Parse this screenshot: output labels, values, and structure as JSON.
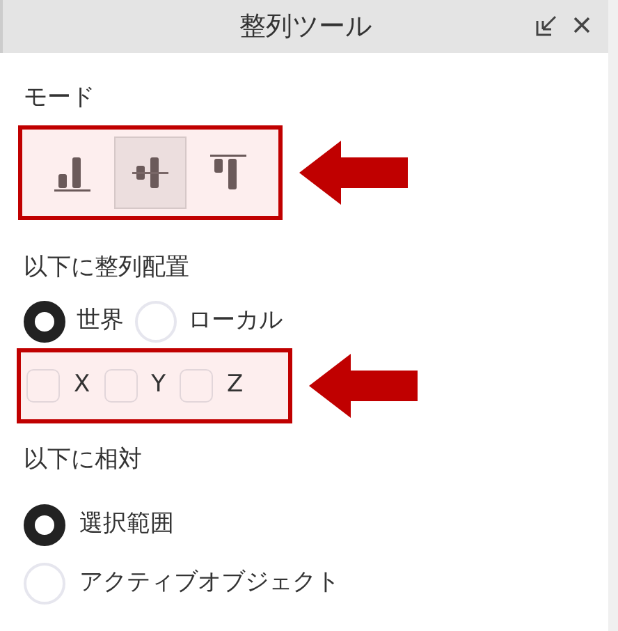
{
  "window": {
    "title": "整列ツール"
  },
  "mode": {
    "label": "モード",
    "buttons": [
      {
        "kind": "bottom",
        "selected": false
      },
      {
        "kind": "center",
        "selected": true
      },
      {
        "kind": "top",
        "selected": false
      }
    ]
  },
  "align_to": {
    "label": "以下に整列配置",
    "options": [
      {
        "label": "世界",
        "selected": true
      },
      {
        "label": "ローカル",
        "selected": false
      }
    ],
    "axes": [
      {
        "label": "X",
        "checked": false
      },
      {
        "label": "Y",
        "checked": false
      },
      {
        "label": "Z",
        "checked": false
      }
    ]
  },
  "relative_to": {
    "label": "以下に相対",
    "options": [
      {
        "label": "選択範囲",
        "selected": true
      },
      {
        "label": "アクティブオブジェクト",
        "selected": false
      }
    ]
  }
}
